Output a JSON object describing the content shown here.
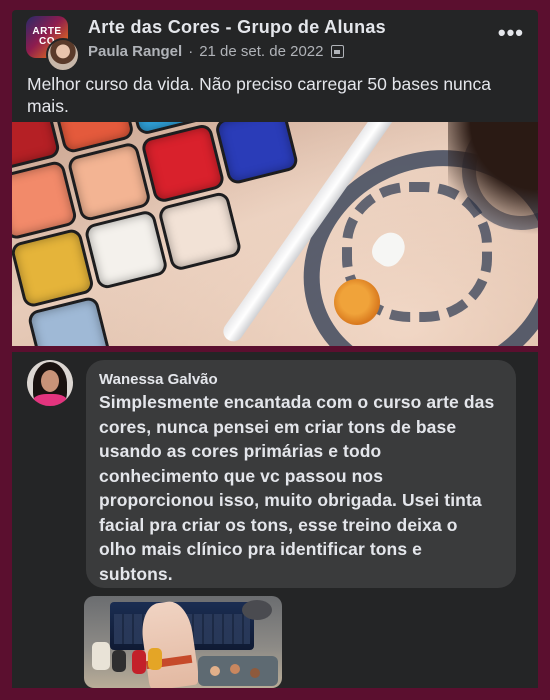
{
  "post": {
    "group_name": "Arte das Cores - Grupo de Alunas",
    "logo_text_line1": "ARTE",
    "logo_text_line2": "CO",
    "author": "Paula Rangel",
    "separator": "·",
    "date": "21 de set. de 2022",
    "privacy_icon": "group-privacy-icon",
    "more_icon": "more-options-icon",
    "more_label": "•••",
    "text": "Melhor curso da vida. Não preciso carregar 50 bases nunca mais."
  },
  "comment": {
    "author": "Wanessa Galvão",
    "text": "Simplesmente encantada com o curso arte das cores, nunca pensei em criar tons de base usando as cores primárias e todo conhecimento que vc passou nos proporcionou isso, muito obrigada. Usei tinta facial pra criar os tons, esse treino deixa o olho mais clínico pra identificar tons e subtons."
  },
  "colors": {
    "frame_border": "#5b0f2f",
    "card_background": "#242526",
    "bubble_background": "#3a3b3c",
    "primary_text": "#e4e6eb",
    "secondary_text": "#b0b3b8"
  }
}
